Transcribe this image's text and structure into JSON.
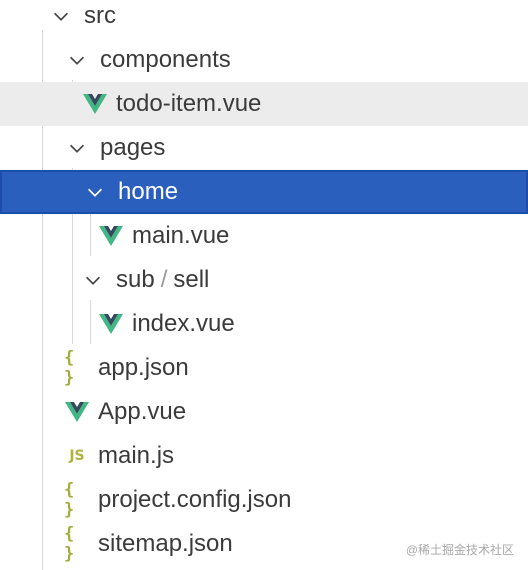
{
  "explorer": {
    "src": "src",
    "components": "components",
    "todo_item": "todo-item.vue",
    "pages": "pages",
    "home": "home",
    "main_vue": "main.vue",
    "sub": "sub",
    "sell": "sell",
    "index_vue": "index.vue",
    "app_json": "app.json",
    "app_vue": "App.vue",
    "main_js": "main.js",
    "project_config": "project.config.json",
    "sitemap": "sitemap.json"
  },
  "icons": {
    "json": "{ }",
    "js": "JS"
  },
  "colors": {
    "selection": "#2b5fbe",
    "vue_green": "#41b883",
    "vue_dark": "#35495e"
  },
  "watermark": "@稀土掘金技术社区"
}
